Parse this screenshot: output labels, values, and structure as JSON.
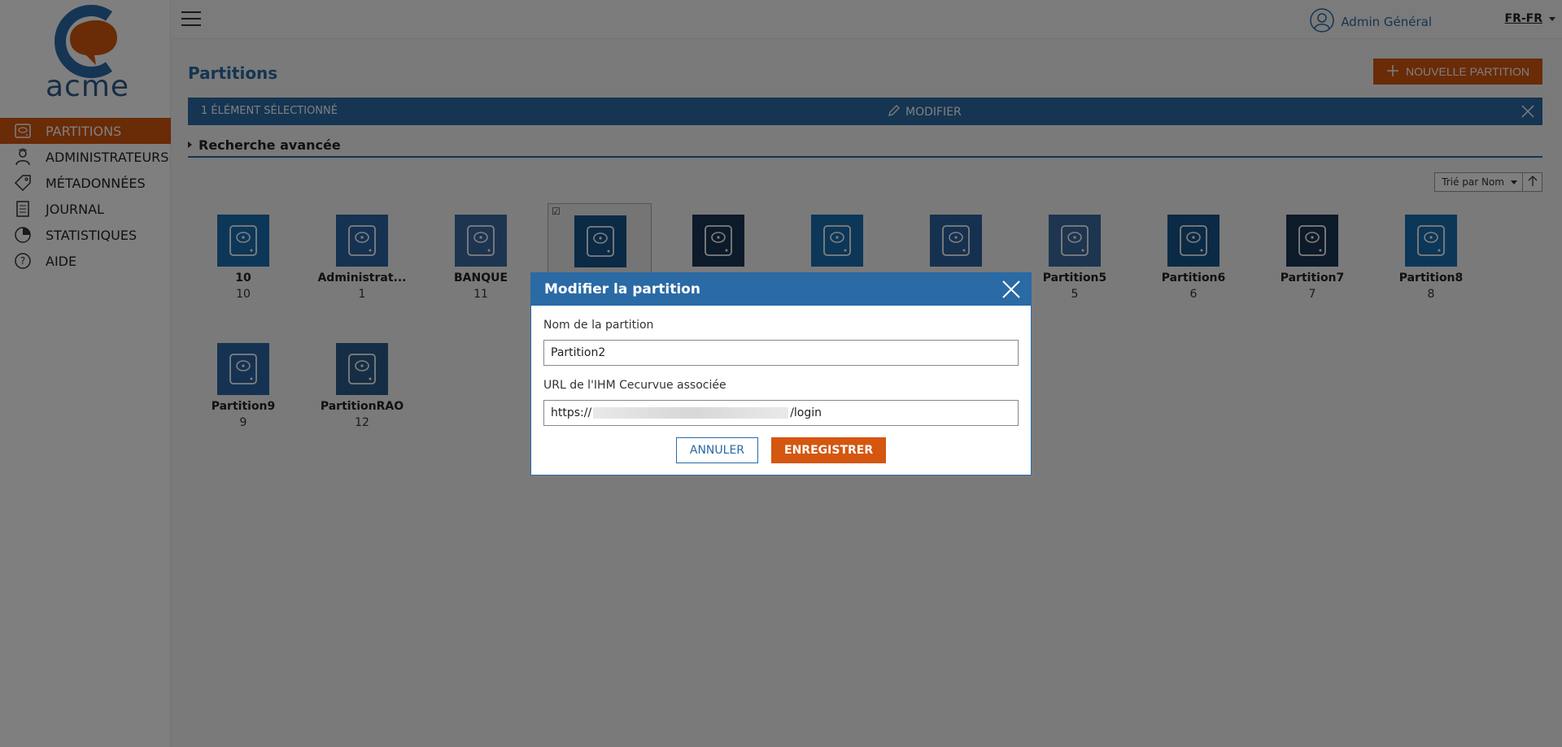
{
  "brand": {
    "logo_text": "acme",
    "color": "#2d5c8a",
    "accent": "#d4560f"
  },
  "sidebar": {
    "items": [
      {
        "label": "PARTITIONS",
        "icon": "disk-icon",
        "active": true
      },
      {
        "label": "ADMINISTRATEURS",
        "icon": "admin-icon",
        "active": false
      },
      {
        "label": "MÉTADONNÉES",
        "icon": "tag-icon",
        "active": false
      },
      {
        "label": "JOURNAL",
        "icon": "journal-icon",
        "active": false
      },
      {
        "label": "STATISTIQUES",
        "icon": "pie-chart-icon",
        "active": false
      },
      {
        "label": "AIDE",
        "icon": "help-icon",
        "active": false
      }
    ]
  },
  "topbar": {
    "user_name": "Admin Général",
    "language": "FR-FR"
  },
  "main": {
    "title": "Partitions",
    "new_button": "NOUVELLE PARTITION",
    "selection": {
      "count_label": "1 ÉLÉMENT SÉLECTIONNÉ",
      "edit_label": "MODIFIER"
    },
    "advanced_search": "Recherche avancée",
    "sort_label": "Trié par Nom",
    "tiles": [
      {
        "name": "10",
        "id": "10",
        "color": "#1a6fb0"
      },
      {
        "name": "Administrat...",
        "id": "1",
        "color": "#2a65a5"
      },
      {
        "name": "BANQUE",
        "id": "11",
        "color": "#3a6aa0"
      },
      {
        "name": "",
        "id": "",
        "color": "#17548a",
        "selected": true
      },
      {
        "name": "",
        "id": "",
        "color": "#1b3552"
      },
      {
        "name": "",
        "id": "",
        "color": "#1a6fb0"
      },
      {
        "name": "",
        "id": "",
        "color": "#2d62a0"
      },
      {
        "name": "Partition5",
        "id": "5",
        "color": "#3a6aa0"
      },
      {
        "name": "Partition6",
        "id": "6",
        "color": "#17548a"
      },
      {
        "name": "Partition7",
        "id": "7",
        "color": "#1b3552"
      },
      {
        "name": "Partition8",
        "id": "8",
        "color": "#1a6fb0"
      },
      {
        "name": "Partition9",
        "id": "9",
        "color": "#2a65a5"
      },
      {
        "name": "PartitionRAO",
        "id": "12",
        "color": "#2d5c8a"
      }
    ]
  },
  "modal": {
    "title": "Modifier la partition",
    "name_label": "Nom de la partition",
    "name_value": "Partition2",
    "url_label": "URL de l'IHM Cecurvue associée",
    "url_prefix": "https://",
    "url_suffix": "/login",
    "cancel_label": "ANNULER",
    "save_label": "ENREGISTRER"
  }
}
